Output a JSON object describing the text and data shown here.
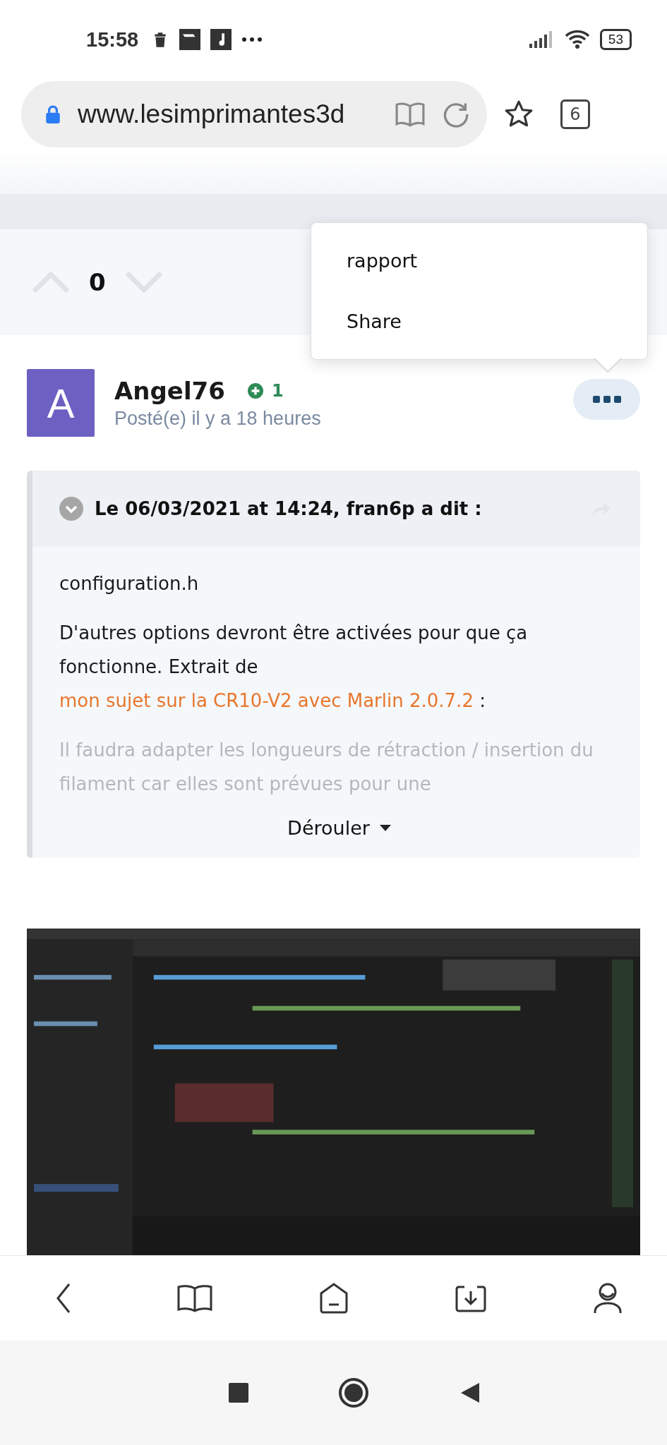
{
  "status_bar": {
    "time": "15:58",
    "battery": "53"
  },
  "browser": {
    "url": "www.lesimprimantes3d",
    "tab_count": "6"
  },
  "vote": {
    "score": "0"
  },
  "menu": {
    "items": [
      "rapport",
      "Share"
    ]
  },
  "post": {
    "avatar_letter": "A",
    "author": "Angel76",
    "reputation": "1",
    "posted": "Posté(e) il y a 18 heures"
  },
  "quote": {
    "header": "Le 06/03/2021 at 14:24, fran6p a dit :",
    "expanded": false,
    "paragraphs": [
      {
        "kind": "plain",
        "text": "configuration.h"
      },
      {
        "kind": "link",
        "before": "D'autres options devront être activées pour que ça fonctionne. Extrait de ",
        "link": "mon sujet sur la CR10-V2 avec Marlin 2.0.7.2",
        "after": " :"
      },
      {
        "kind": "faded",
        "text": "Il faudra adapter les longueurs de rétraction / insertion du filament car elles sont prévues pour une"
      }
    ],
    "toggle": "Dérouler"
  }
}
